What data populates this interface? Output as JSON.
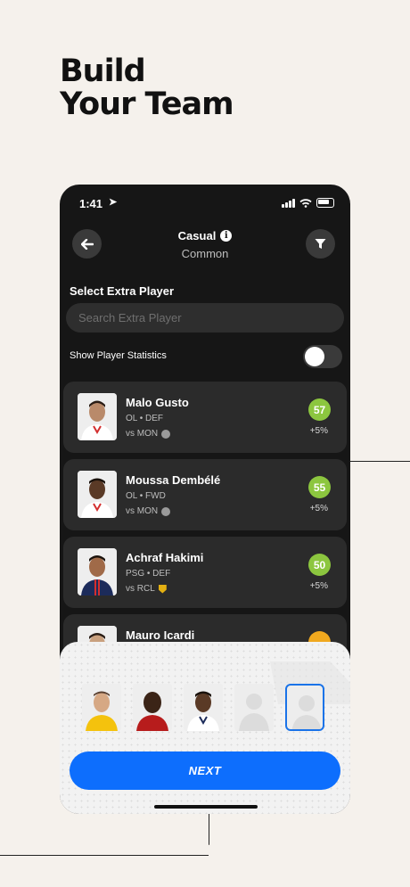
{
  "headline": {
    "line1": "Build",
    "line2": "Your Team"
  },
  "status_bar": {
    "time": "1:41"
  },
  "header": {
    "title": "Casual",
    "subtitle": "Common",
    "info_glyph": "i"
  },
  "section": {
    "title": "Select Extra Player"
  },
  "search": {
    "placeholder": "Search Extra Player",
    "value": ""
  },
  "stats_toggle": {
    "label": "Show Player Statistics",
    "enabled": false
  },
  "players": [
    {
      "name": "Malo Gusto",
      "meta": "OL • DEF",
      "vs": "vs MON",
      "score": "57",
      "change": "+5%",
      "score_color": "#8cc63f"
    },
    {
      "name": "Moussa Dembélé",
      "meta": "OL • FWD",
      "vs": "vs MON",
      "score": "55",
      "change": "+5%",
      "score_color": "#8cc63f"
    },
    {
      "name": "Achraf Hakimi",
      "meta": "PSG • DEF",
      "vs": "vs RCL",
      "score": "50",
      "change": "+5%",
      "score_color": "#8cc63f"
    },
    {
      "name": "Mauro Icardi",
      "meta": "",
      "vs": "",
      "score": "",
      "change": "",
      "score_color": "#f0a81e"
    }
  ],
  "team_slots": {
    "filled": 3,
    "empty": 2
  },
  "next_button": {
    "label": "NEXT"
  },
  "colors": {
    "accent": "#0d6efd",
    "score_green": "#8cc63f",
    "score_orange": "#f0a81e"
  }
}
